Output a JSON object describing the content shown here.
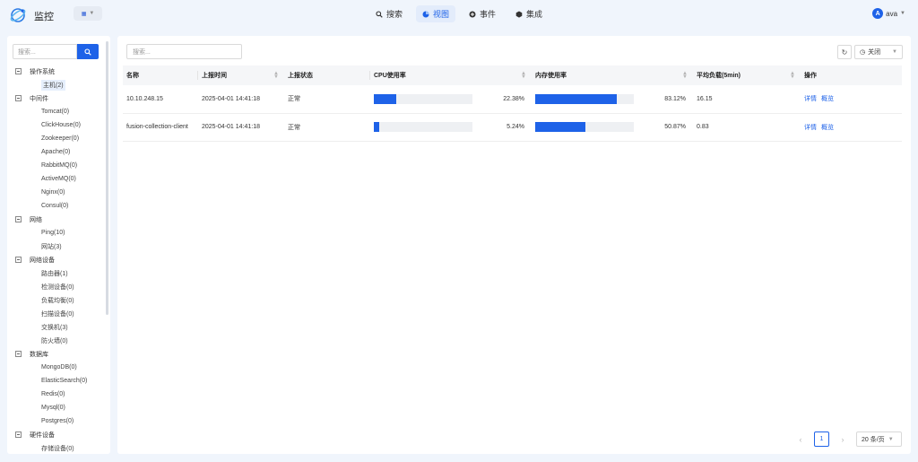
{
  "app": {
    "title": "监控",
    "switcher_icon": "grid-icon"
  },
  "nav": [
    {
      "label": "搜索",
      "icon": "search-icon",
      "active": false
    },
    {
      "label": "视图",
      "icon": "pie-icon",
      "active": true
    },
    {
      "label": "事件",
      "icon": "event-icon",
      "active": false
    },
    {
      "label": "集成",
      "icon": "cube-icon",
      "active": false
    }
  ],
  "user": {
    "avatar": "A",
    "name": "ava"
  },
  "sidebar": {
    "search_placeholder": "搜索...",
    "tree": [
      {
        "label": "操作系统",
        "children": [
          {
            "label": "主机(2)",
            "selected": true
          }
        ]
      },
      {
        "label": "中间件",
        "children": [
          {
            "label": "Tomcat(0)"
          },
          {
            "label": "ClickHouse(0)"
          },
          {
            "label": "Zookeeper(0)"
          },
          {
            "label": "Apache(0)"
          },
          {
            "label": "RabbitMQ(0)"
          },
          {
            "label": "ActiveMQ(0)"
          },
          {
            "label": "Nginx(0)"
          },
          {
            "label": "Consul(0)"
          }
        ]
      },
      {
        "label": "网络",
        "children": [
          {
            "label": "Ping(10)"
          },
          {
            "label": "网站(3)"
          }
        ]
      },
      {
        "label": "网络设备",
        "children": [
          {
            "label": "路由器(1)"
          },
          {
            "label": "检测设备(0)"
          },
          {
            "label": "负载均衡(0)"
          },
          {
            "label": "扫描设备(0)"
          },
          {
            "label": "交换机(3)"
          },
          {
            "label": "防火墙(0)"
          }
        ]
      },
      {
        "label": "数据库",
        "children": [
          {
            "label": "MongoDB(0)"
          },
          {
            "label": "ElasticSearch(0)"
          },
          {
            "label": "Redis(0)"
          },
          {
            "label": "Mysql(0)"
          },
          {
            "label": "Postgres(0)"
          }
        ]
      },
      {
        "label": "硬件设备",
        "children": [
          {
            "label": "存储设备(0)"
          }
        ]
      }
    ]
  },
  "main": {
    "search_placeholder": "搜索...",
    "refresh_icon": "refresh-icon",
    "auto_refresh": "关闭",
    "columns": [
      "名称",
      "上报时间",
      "上报状态",
      "CPU使用率",
      "内存使用率",
      "平均负载(5min)",
      "操作"
    ],
    "rows": [
      {
        "name": "10.10.248.15",
        "time": "2025-04-01 14:41:18",
        "status": "正常",
        "cpu": "22.38%",
        "cpu_frac": 0.2238,
        "mem": "83.12%",
        "mem_frac": 0.8312,
        "load": "16.15",
        "op_detail": "详情",
        "op_overview": "概览"
      },
      {
        "name": "fusion-collection-client",
        "time": "2025-04-01 14:41:18",
        "status": "正常",
        "cpu": "5.24%",
        "cpu_frac": 0.0524,
        "mem": "50.87%",
        "mem_frac": 0.5087,
        "load": "0.83",
        "op_detail": "详情",
        "op_overview": "概览"
      }
    ]
  },
  "pager": {
    "prev": "‹",
    "page": "1",
    "next": "›",
    "page_size": "20 条/页"
  },
  "colors": {
    "accent": "#1e62e8"
  }
}
